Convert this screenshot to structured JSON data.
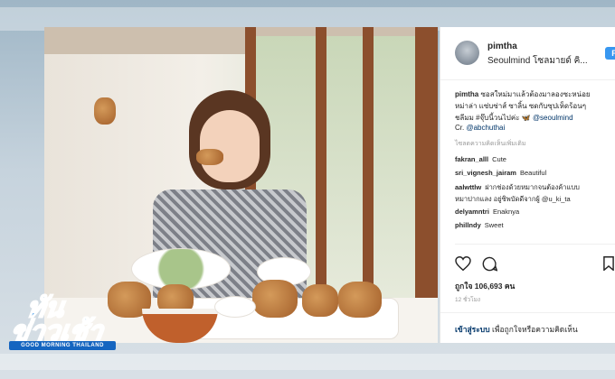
{
  "post": {
    "username": "pimtha",
    "location": "Seoulmind โซลมายด์ คิ...",
    "follow_label": "F",
    "caption_user": "pimtha",
    "caption_line1": "ซอสใหม่มาแล้วต้องมาลองซะหน่อย",
    "caption_line2": "หม่าล่า แซ่บซ่าส์ ซาลิ้น ซดกับซุปเห็ดร้อนๆ",
    "caption_line3_a": "ชลีมม #จุ๊บนี้วนไปค่ะ",
    "caption_line3_b": "@seoulmind",
    "caption_line4_a": "Cr. ",
    "caption_line4_b": "@abchuthai",
    "translate_label": "ไซลดความคิดเห็นเพิ่มเติม",
    "comments": [
      {
        "user": "fakran_alll",
        "text": "Cute"
      },
      {
        "user": "sri_vignesh_jairam",
        "text": "Beautiful"
      },
      {
        "user": "aalwttlw",
        "text": "ฝากช่องด้วยหมากจนต้องค้าแบบ"
      },
      {
        "user": "",
        "text": "หมาปากแลง อยู่ซิพบัดดีจากผู้ @u_ki_ta"
      },
      {
        "user": "delyamntri",
        "text": "Enaknya"
      },
      {
        "user": "phillndy",
        "text": "Sweet"
      }
    ],
    "likes": "ถูกใจ 106,693 คน",
    "time_ago": "12 ชั่วโมง",
    "login_link": "เข้าสู่ระบบ",
    "login_text": " เพื่อถูกใจหรือความคิดเห็น"
  },
  "icons": {
    "heart": "heart-icon",
    "comment": "comment-icon",
    "bookmark": "bookmark-icon"
  },
  "logo": {
    "line1": "ทัน",
    "line2": "ข่าวเช้า",
    "sub": "GOOD MORNING THAILAND"
  },
  "colors": {
    "link": "#003569",
    "follow": "#3897f0",
    "logo_blue": "#1e88e5"
  }
}
